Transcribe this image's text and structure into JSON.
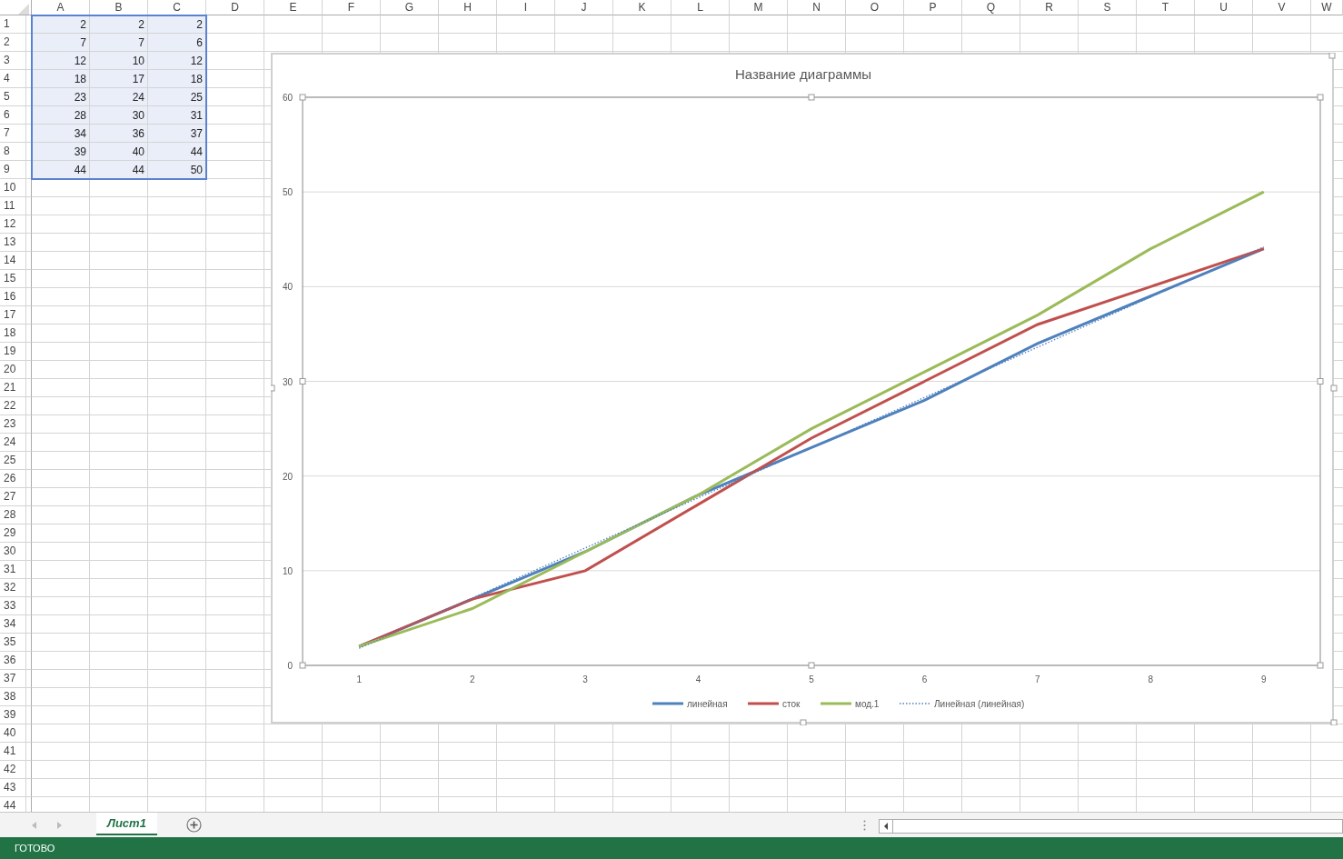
{
  "sheet": {
    "columns": [
      "A",
      "B",
      "C",
      "D",
      "E",
      "F",
      "G",
      "H",
      "I",
      "J",
      "K",
      "L",
      "M",
      "N",
      "O",
      "P",
      "Q",
      "R",
      "S",
      "T",
      "U",
      "V",
      "W"
    ],
    "row_numbers": [
      "1",
      "2",
      "3",
      "4",
      "5",
      "6",
      "7",
      "8",
      "9",
      "10",
      "11",
      "12",
      "13",
      "14",
      "15",
      "16",
      "17",
      "18",
      "19",
      "20",
      "21",
      "22",
      "23",
      "24",
      "25",
      "26",
      "27",
      "28",
      "29",
      "30",
      "31",
      "32",
      "33",
      "34",
      "35",
      "36",
      "37",
      "38",
      "39",
      "40",
      "41",
      "42",
      "43",
      "44"
    ],
    "rows": [
      {
        "cells": [
          "2",
          "2",
          "2"
        ],
        "selected": true
      },
      {
        "cells": [
          "7",
          "7",
          "6"
        ],
        "selected": true
      },
      {
        "cells": [
          "12",
          "10",
          "12"
        ],
        "selected": true
      },
      {
        "cells": [
          "18",
          "17",
          "18"
        ],
        "selected": true
      },
      {
        "cells": [
          "23",
          "24",
          "25"
        ],
        "selected": true
      },
      {
        "cells": [
          "28",
          "30",
          "31"
        ],
        "selected": true
      },
      {
        "cells": [
          "34",
          "36",
          "37"
        ],
        "selected": true
      },
      {
        "cells": [
          "39",
          "40",
          "44"
        ],
        "selected": true
      },
      {
        "cells": [
          "44",
          "44",
          "50"
        ],
        "selected": true
      }
    ]
  },
  "chart": {
    "chart_data": {
      "type": "line",
      "title": "Название диаграммы",
      "grid": true,
      "legend": true,
      "categories": [
        "1",
        "2",
        "3",
        "4",
        "5",
        "6",
        "7",
        "8",
        "9"
      ],
      "ylim": [
        0,
        60
      ],
      "yticks": [
        0,
        10,
        20,
        30,
        40,
        50,
        60
      ],
      "series": [
        {
          "name": "линейная",
          "color": "#4f81bd",
          "line_style": "solid",
          "values": [
            2,
            7,
            12,
            18,
            23,
            28,
            34,
            39,
            44
          ]
        },
        {
          "name": "сток",
          "color": "#c0504d",
          "line_style": "solid",
          "values": [
            2,
            7,
            10,
            17,
            24,
            30,
            36,
            40,
            44
          ]
        },
        {
          "name": "мод.1",
          "color": "#9bbb59",
          "line_style": "solid",
          "values": [
            2,
            6,
            12,
            18,
            25,
            31,
            37,
            44,
            50
          ]
        },
        {
          "name": "Линейная (линейная)",
          "color": "#4f81bd",
          "line_style": "dotted",
          "values": [
            1.8,
            7.1,
            12.4,
            17.7,
            23,
            28.3,
            33.6,
            38.9,
            44.2
          ]
        }
      ]
    }
  },
  "tabs": [
    {
      "label": "Лист1",
      "selected": true
    }
  ],
  "status_bar": {
    "text": "ГОТОВО"
  }
}
